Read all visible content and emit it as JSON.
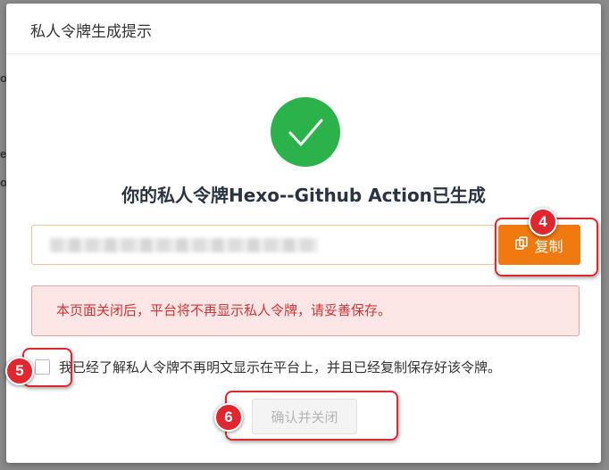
{
  "modal": {
    "title": "私人令牌生成提示",
    "headline": "你的私人令牌Hexo--Github Action已生成",
    "copy_button": "复制",
    "warning": "本页面关闭后，平台将不再显示私人令牌，请妥善保存。",
    "agree_text": "我已经了解私人令牌不再明文显示在平台上，并且已经复制保存好该令牌。",
    "confirm_button": "确认并关闭",
    "agree_checked": false
  },
  "annotations": [
    {
      "number": "4"
    },
    {
      "number": "5"
    },
    {
      "number": "6"
    }
  ],
  "background": {
    "edge_letters": [
      "o",
      "e",
      "o"
    ]
  },
  "colors": {
    "success": "#2cb24a",
    "copy_button": "#f07a10",
    "warning_text": "#d23434",
    "warning_bg": "#fde6e6",
    "annotation": "#e0262f"
  },
  "icons": {
    "success": "checkmark-icon",
    "copy": "copy-icon"
  }
}
